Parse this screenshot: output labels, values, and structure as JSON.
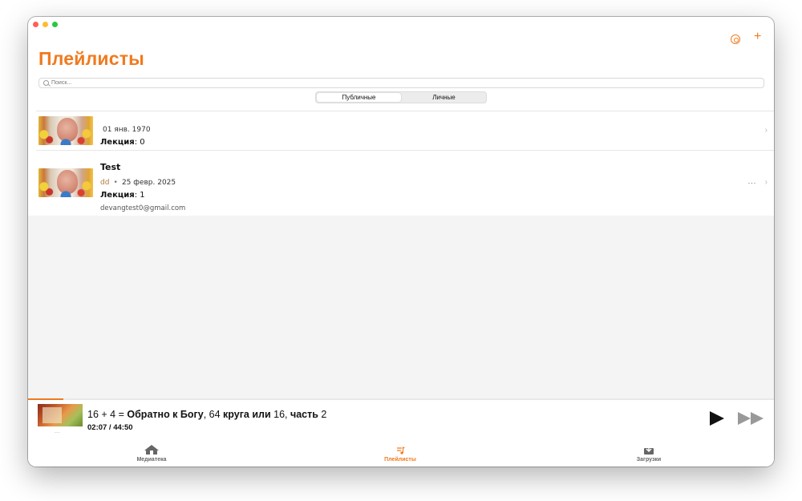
{
  "colors": {
    "accent": "#f07a1e",
    "background": "#f4f4f4"
  },
  "header": {
    "title": "Плейлисты",
    "settings_icon": "settings-circle-icon",
    "add_icon": "plus-icon"
  },
  "search": {
    "placeholder": "Поиск...",
    "value": ""
  },
  "segments": {
    "public": "Публичные",
    "private": "Личные",
    "selected": "Публичные"
  },
  "playlists": [
    {
      "title": "",
      "date": "01 янв. 1970",
      "lectures_label": "Лекция",
      "lectures_value": ": 0"
    },
    {
      "title": "Test",
      "author": "dd",
      "bullet": "•",
      "date": "25 февр. 2025",
      "lectures_label": "Лекция",
      "lectures_value": ": 1",
      "email": "devangtest0@gmail.com",
      "more": "···"
    }
  ],
  "player": {
    "title_prefix": "16 + 4 = ",
    "title_bold1": "Обратно к Богу",
    "title_mid1": ", 64 ",
    "title_bold2": "круга или",
    "title_mid2": " 16, ",
    "title_bold3": "часть",
    "title_suffix": " 2",
    "time": "02:07 / 44:50",
    "progress": 0.047,
    "cover_caption": "......"
  },
  "tabs": [
    {
      "label": "Медиатека",
      "icon": "home-icon",
      "active": false
    },
    {
      "label": "Плейлисты",
      "icon": "playlist-icon",
      "active": true
    },
    {
      "label": "Загрузки",
      "icon": "download-icon",
      "active": false
    }
  ]
}
